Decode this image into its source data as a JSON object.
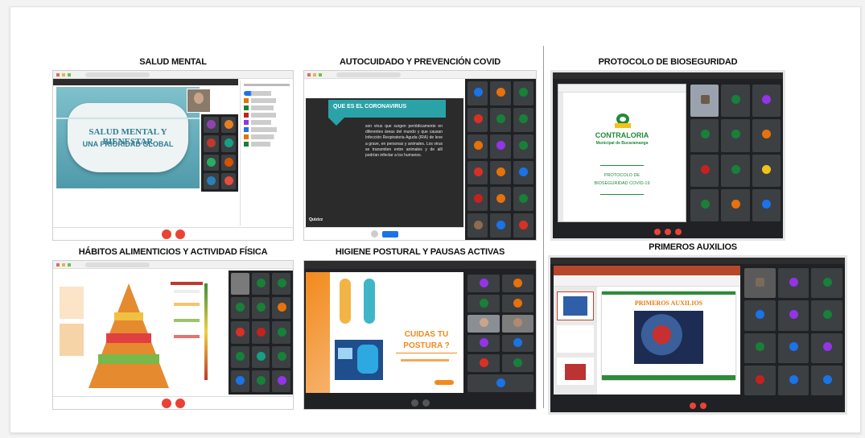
{
  "panels": {
    "salud": {
      "title": "SALUD MENTAL",
      "slide_line1": "SALUD MENTAL Y BIENESTAR",
      "slide_line2": "UNA PRIORIDAD GLOBAL"
    },
    "covid": {
      "title": "AUTOCUIDADO Y PREVENCIÓN COVID",
      "heading": "QUE ES EL CORONAVIRUS",
      "body": "son virus que surgen periódicamente en diferentes áreas del mundo y que causan Infección Respiratoria Aguda (IRA) de leve a grave, en personas y animales. Los virus se transmiten entre animales y de allí podrían infectar a los humanos.",
      "footer_logo": "Quizizz"
    },
    "protocolo": {
      "title": "PROTOCOLO DE BIOSEGURIDAD",
      "brand_name": "CONTRALORIA",
      "brand_sub": "Municipal de Bucaramanga",
      "doc_title_1": "PROTOCOLO DE",
      "doc_title_2": "BIOSEGURIDAD COVID-19"
    },
    "habitos": {
      "title": "HÁBITOS ALIMENTICIOS Y ACTIVIDAD FÍSICA"
    },
    "higiene": {
      "title": "HIGIENE POSTURAL Y PAUSAS ACTIVAS",
      "slide_title_1": "CUIDAS TU",
      "slide_title_2": "POSTURA ?"
    },
    "auxilios": {
      "title": "PRIMEROS AUXILIOS",
      "slide_title": "PRIMEROS AUXILIOS"
    }
  },
  "colors": {
    "meet_dark": "#202124",
    "tile": "#3c4043",
    "end_call": "#ea4335",
    "mask_blue": "#5fa9b8",
    "covid_teal": "#2aa3a8",
    "brand_green": "#1f8a3a",
    "brand_yellow": "#f2c21b",
    "posture_orange": "#f28a1c",
    "ppt_red": "#b7472a",
    "slide_green": "#2e8b3a"
  }
}
